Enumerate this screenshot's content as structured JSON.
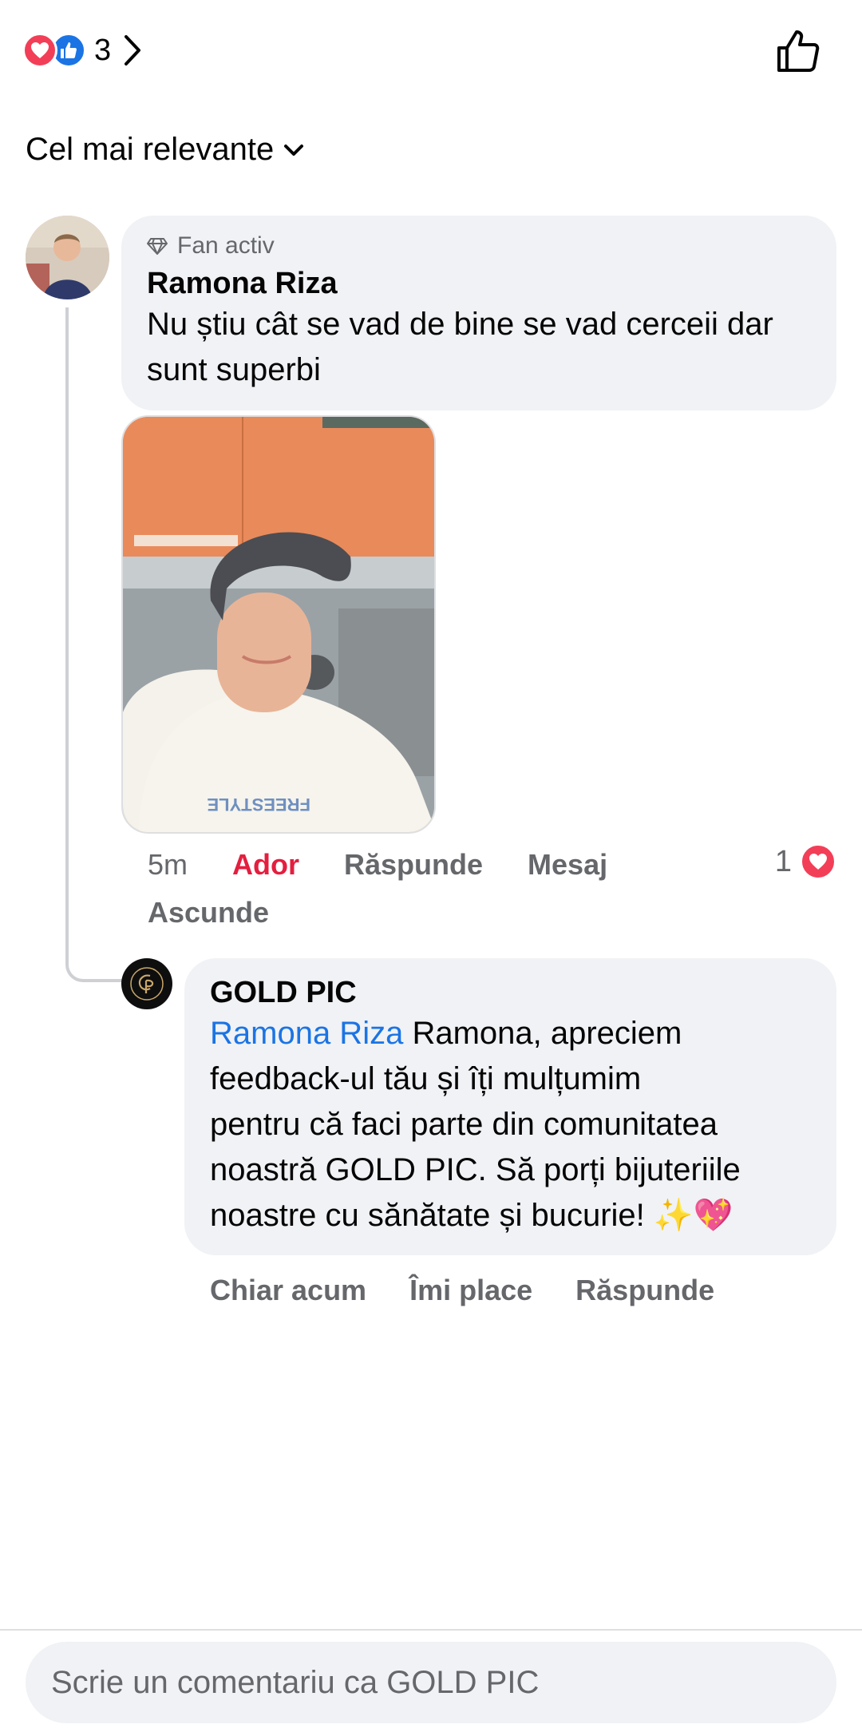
{
  "reactions": {
    "count": "3",
    "icons": [
      "heart-icon",
      "like-icon"
    ]
  },
  "sort": {
    "label": "Cel mai relevante"
  },
  "comments": [
    {
      "badge": "Fan activ",
      "author": "Ramona Riza",
      "text": "Nu știu cât se vad de bine se vad cerceii dar sunt superbi",
      "time": "5m",
      "react_label": "Ador",
      "reply_label": "Răspunde",
      "message_label": "Mesaj",
      "hide_label": "Ascunde",
      "reaction_count": "1"
    },
    {
      "author": "GOLD PIC",
      "mention": "Ramona Riza",
      "text_line1": " Ramona, apreciem",
      "text_line2": "feedback-ul tău și îți mulțumim",
      "text_line3": "pentru că faci parte din comunitatea",
      "text_line4": "noastră GOLD PIC. Să porți bijuteriile",
      "text_line5": "noastre cu sănătate și bucurie! ✨💖",
      "time": "Chiar acum",
      "like_label": "Îmi place",
      "reply_label": "Răspunde"
    }
  ],
  "composer": {
    "placeholder": "Scrie un comentariu ca GOLD PIC"
  },
  "colors": {
    "heart": "#f33e58",
    "like": "#1b74e4",
    "bubble": "#f0f2f5",
    "secondary_text": "#65676b",
    "love_action": "#e41e3f"
  }
}
